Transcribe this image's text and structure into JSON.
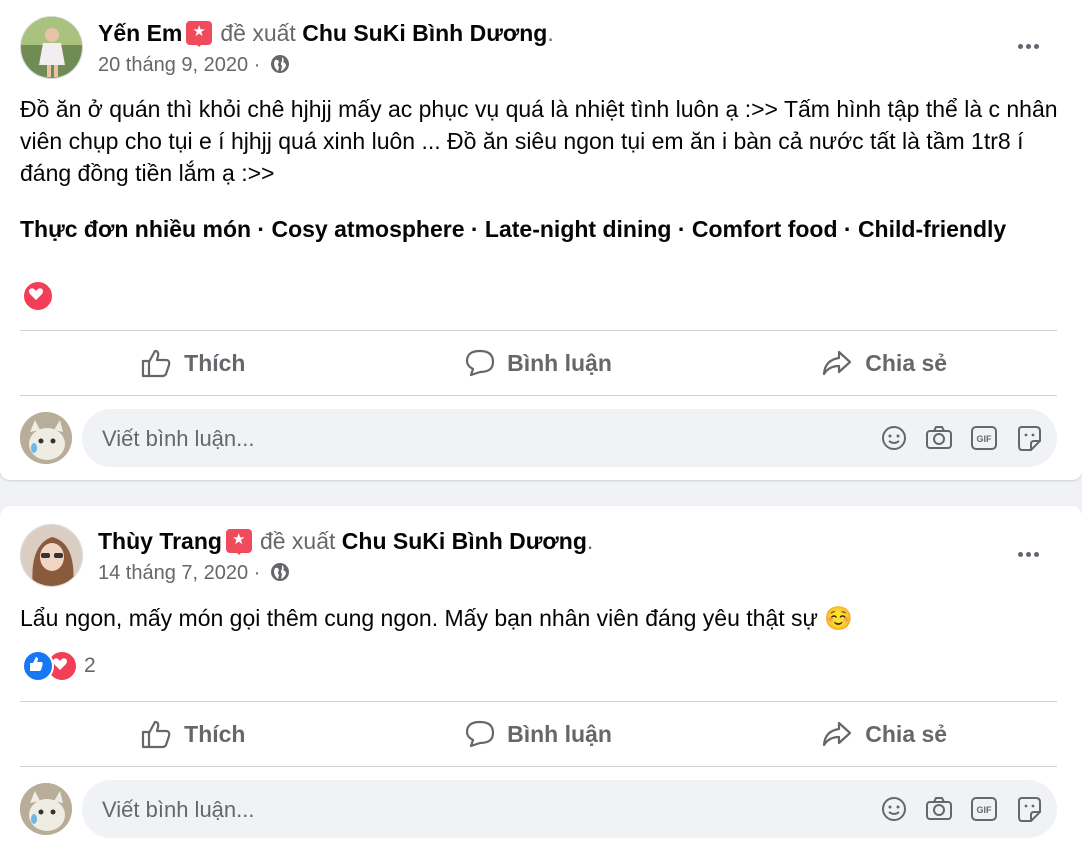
{
  "posts": [
    {
      "author": "Yến Em",
      "verb": "đề xuất",
      "page": "Chu SuKi Bình Dương",
      "date": "20 tháng 9, 2020",
      "date_sep": "·",
      "text": "Đồ ăn ở quán thì khỏi chê hjhjj mấy ac phục vụ quá là nhiệt tình luôn ạ :>> Tấm hình tập thể là c nhân viên chụp cho tụi e í hjhjj quá xinh luôn ... Đồ ăn siêu ngon tụi em ăn i bàn cả nước tất là tầm 1tr8 í đáng đồng tiền lắm ạ :>>",
      "tags": "Thực đơn nhiều món · Cosy atmosphere · Late-night dining · Comfort food · Child-friendly",
      "reactions": [
        "love"
      ],
      "reaction_count": ""
    },
    {
      "author": "Thùy Trang",
      "verb": "đề xuất",
      "page": "Chu SuKi Bình Dương",
      "date": "14 tháng 7, 2020",
      "date_sep": "·",
      "text": "Lẩu ngon, mấy món gọi thêm cung ngon. Mấy bạn nhân viên đáng yêu thật sự ☺️",
      "tags": "",
      "reactions": [
        "like",
        "love"
      ],
      "reaction_count": "2"
    }
  ],
  "actions": {
    "like": "Thích",
    "comment": "Bình luận",
    "share": "Chia sẻ"
  },
  "comment": {
    "placeholder": "Viết bình luận..."
  },
  "colors": {
    "accent_like": "#1877f2",
    "love": "#f33e58",
    "badge": "#f04a5d",
    "muted": "#65676b"
  },
  "icons": [
    "globe-icon",
    "more-icon",
    "like-icon",
    "comment-icon",
    "share-icon",
    "emoji-icon",
    "camera-icon",
    "gif-icon",
    "sticker-icon",
    "love-reaction-icon",
    "like-reaction-icon"
  ]
}
